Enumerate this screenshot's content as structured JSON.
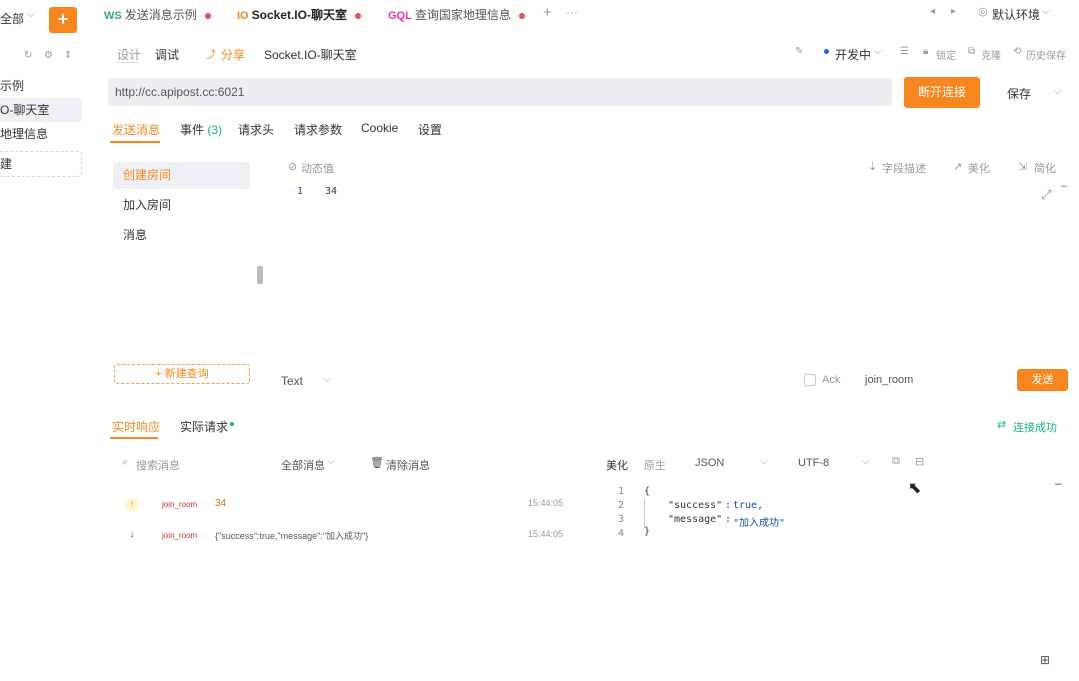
{
  "sidebar": {
    "dropdown_label": "全部",
    "add_label": "+",
    "items": [
      {
        "label": "示例"
      },
      {
        "label": "O-聊天室"
      },
      {
        "label": "地理信息"
      }
    ],
    "new_group_label": "建"
  },
  "tabs": [
    {
      "proto": "WS",
      "title": "发送消息示例",
      "proto_color": "#3aa876"
    },
    {
      "proto": "IO",
      "title": "Socket.IO-聊天室",
      "proto_color": "#f0891f"
    },
    {
      "proto": "GQL",
      "title": "查询国家地理信息",
      "proto_color": "#e535ab"
    }
  ],
  "env": {
    "label": "默认环境"
  },
  "toolbar": {
    "design": "设计",
    "debug": "调试",
    "share": "分享",
    "api_name": "Socket.IO-聊天室",
    "status": "开发中",
    "lock": "锁定",
    "clone": "克隆",
    "history": "历史保存"
  },
  "url": {
    "value": "http://cc.apipost.cc:6021"
  },
  "buttons": {
    "disconnect": "断开连接",
    "save": "保存",
    "send": "发送"
  },
  "subtabs": [
    {
      "label": "发送消息"
    },
    {
      "label": "事件"
    },
    {
      "label": "请求头"
    },
    {
      "label": "请求参数"
    },
    {
      "label": "Cookie"
    },
    {
      "label": "设置"
    }
  ],
  "event_count": "(3)",
  "messages": [
    {
      "label": "创建房间"
    },
    {
      "label": "加入房间"
    },
    {
      "label": "消息"
    }
  ],
  "editor": {
    "dynamic": "动态值",
    "field_desc": "字段描述",
    "beautify": "美化",
    "simplify": "简化",
    "line_no": "1",
    "line_text": "34"
  },
  "new_query": "+ 新建查询",
  "format": {
    "type": "Text",
    "ack": "Ack",
    "event_name": "join_room"
  },
  "response": {
    "tab_actual_response": "实时响应",
    "tab_actual_request": "实际请求",
    "connected": "连接成功",
    "search_placeholder": "搜索消息",
    "all_messages": "全部消息",
    "clear_messages": "清除消息",
    "beautify": "美化",
    "raw": "原生",
    "format": "JSON",
    "encoding": "UTF-8",
    "rows": [
      {
        "event": "join_room",
        "content": "34",
        "time": "15:44:05",
        "direction": "up"
      },
      {
        "event": "join_room",
        "content": "{\"success\":true,\"message\":\"加入成功\"}",
        "time": "15:44:05",
        "direction": "down"
      }
    ],
    "json_lines": [
      {
        "n": "1",
        "text": "{"
      },
      {
        "n": "2",
        "key": "\"success\"",
        "val": "true,"
      },
      {
        "n": "3",
        "key": "\"message\"",
        "val": "\"加入成功\""
      },
      {
        "n": "4",
        "text": "}"
      }
    ]
  },
  "colors": {
    "accent": "#f7861e",
    "connected": "#18b57a",
    "key": "#333333",
    "string": "#1a4fa0"
  }
}
